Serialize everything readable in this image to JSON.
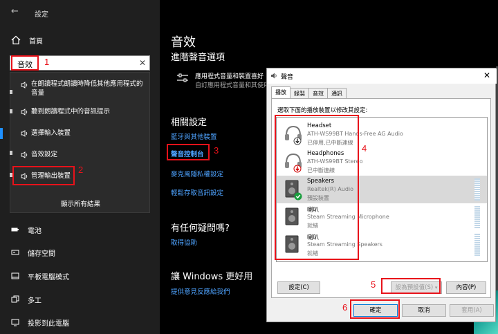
{
  "window": {
    "title": "設定"
  },
  "sidebar": {
    "home_label": "首頁",
    "search": {
      "value": "音效"
    },
    "suggestions": [
      {
        "label": "在朗讀程式朗讀時降低其他應用程式的音量",
        "icon": "speaker-icon"
      },
      {
        "label": "聽到朗讀程式中的音訊提示",
        "icon": "speaker-icon"
      },
      {
        "label": "選擇輸入裝置",
        "icon": "speaker-icon"
      },
      {
        "label": "音效設定",
        "icon": "speaker-icon"
      },
      {
        "label": "管理輸出裝置",
        "icon": "speaker-icon"
      }
    ],
    "show_all": "顯示所有結果",
    "nav_items": [
      {
        "label": "電池",
        "icon": "battery-icon"
      },
      {
        "label": "儲存空間",
        "icon": "storage-icon"
      },
      {
        "label": "平板電腦模式",
        "icon": "tablet-icon"
      },
      {
        "label": "多工",
        "icon": "multitask-icon"
      },
      {
        "label": "投影到此電腦",
        "icon": "project-icon"
      }
    ]
  },
  "content": {
    "title": "音效",
    "subtitle": "進階聲音選項",
    "advanced": {
      "line1": "應用程式音量和裝置喜好",
      "line2": "自訂應用程式音量和其使用"
    },
    "related_title": "相關設定",
    "related_links": [
      "藍牙與其他裝置",
      "聲音控制台",
      "麥克風隱私權設定",
      "輕鬆存取音訊設定"
    ],
    "question_title": "有任何疑問嗎?",
    "help_link": "取得協助",
    "improve_title": "讓 Windows 更好用",
    "feedback_link": "提供意見反應給我們"
  },
  "sound_dialog": {
    "title": "聲音",
    "close_glyph": "✕",
    "tabs": [
      "播放",
      "錄製",
      "音效",
      "通訊"
    ],
    "active_tab": "播放",
    "caption": "選取下面的播放裝置以修改其設定:",
    "devices": [
      {
        "name": "Headset",
        "desc": "ATH-WS99BT Hands-Free AG Audio",
        "status": "已停用,已中斷連線",
        "icon": "headset-icon",
        "badge": "down-arrow-badge"
      },
      {
        "name": "Headphones",
        "desc": "ATH-WS99BT Stereo",
        "status": "已中斷連線",
        "icon": "headphones-icon",
        "badge": "red-down-arrow-badge"
      },
      {
        "name": "Speakers",
        "desc": "Realtek(R) Audio",
        "status": "預設裝置",
        "icon": "speaker-box-icon",
        "badge": "green-check-badge",
        "selected": true
      },
      {
        "name": "喇叭",
        "desc": "Steam Streaming Microphone",
        "status": "就緒",
        "icon": "speaker-box-icon",
        "badge": ""
      },
      {
        "name": "喇叭",
        "desc": "Steam Streaming Speakers",
        "status": "就緒",
        "icon": "speaker-box-icon",
        "badge": ""
      }
    ],
    "configure_button": "設定(C)",
    "set_default_button": "設為預設值(S)",
    "properties_button": "內容(P)",
    "ok_button": "確定",
    "cancel_button": "取消",
    "apply_button": "套用(A)"
  },
  "annotations": [
    "1",
    "2",
    "3",
    "4",
    "5",
    "6"
  ],
  "colors": {
    "accent": "#1e90ff",
    "link": "#4ea3ff",
    "highlight": "#e8121a"
  }
}
